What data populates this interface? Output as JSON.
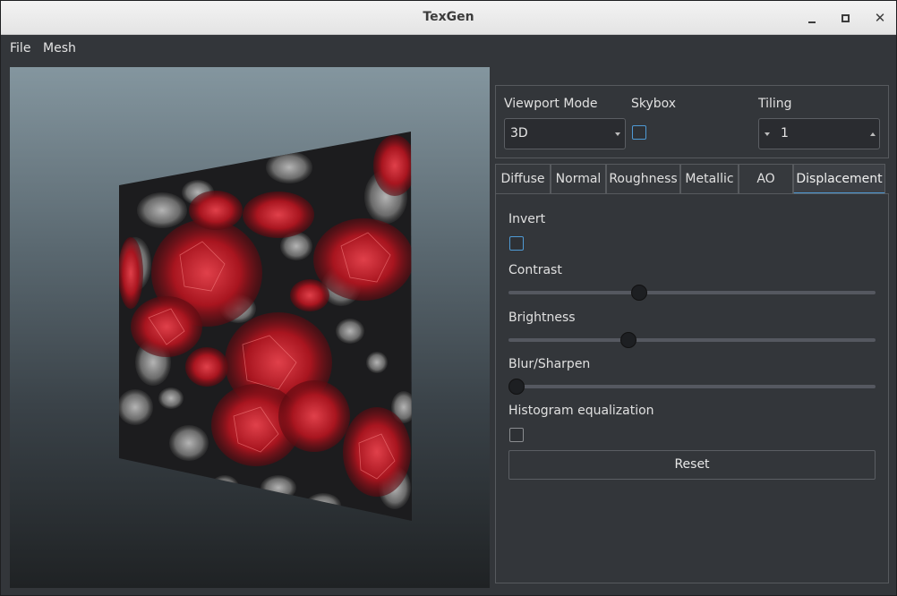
{
  "window": {
    "title": "TexGen"
  },
  "menu": {
    "file": "File",
    "mesh": "Mesh"
  },
  "viewport_controls": {
    "viewport_mode_label": "Viewport Mode",
    "viewport_mode_value": "3D",
    "skybox_label": "Skybox",
    "skybox_checked": false,
    "tiling_label": "Tiling",
    "tiling_value": "1"
  },
  "tabs": [
    {
      "label": "Diffuse"
    },
    {
      "label": "Normal"
    },
    {
      "label": "Roughness"
    },
    {
      "label": "Metallic"
    },
    {
      "label": "AO"
    },
    {
      "label": "Displacement",
      "active": true
    }
  ],
  "displacement": {
    "invert_label": "Invert",
    "invert_checked": false,
    "contrast_label": "Contrast",
    "contrast_value": 0.35,
    "brightness_label": "Brightness",
    "brightness_value": 0.32,
    "blur_label": "Blur/Sharpen",
    "blur_value": 0.0,
    "histogram_label": "Histogram equalization",
    "histogram_checked": false,
    "reset_label": "Reset"
  },
  "colors": {
    "accent": "#4f9ad4",
    "texture_red": "#b0202a",
    "background": "#33363a"
  }
}
